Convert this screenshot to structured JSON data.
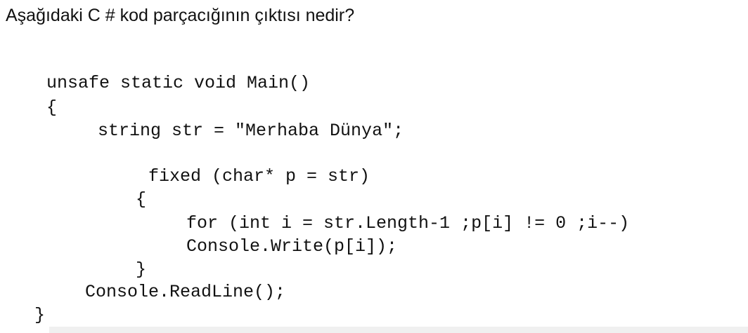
{
  "question": "Aşağıdaki C # kod parçacığının çıktısı nedir?",
  "code": {
    "lines": [
      "unsafe static void Main()",
      "{",
      "string str = \"Merhaba Dünya\";",
      "fixed (char* p = str)",
      "{",
      "for (int i = str.Length-1 ;p[i] != 0 ;i--)",
      "Console.Write(p[i]);",
      "}",
      "Console.ReadLine();",
      "}"
    ]
  }
}
